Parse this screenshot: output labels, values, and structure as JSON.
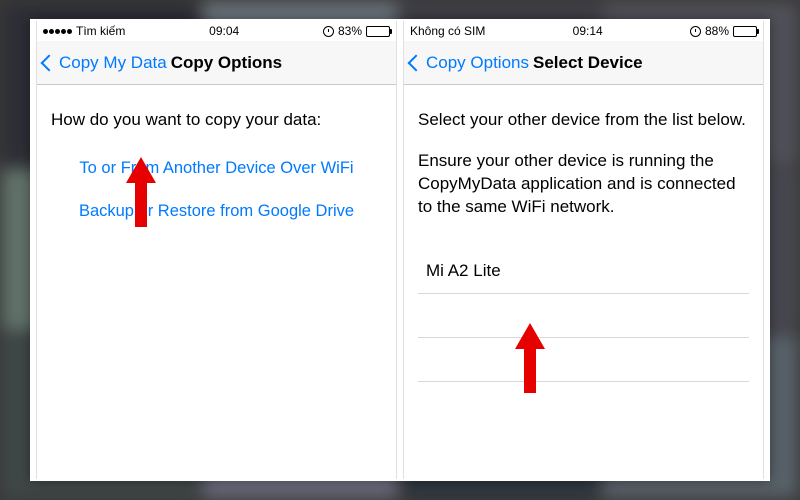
{
  "left": {
    "status": {
      "carrier": "Tìm kiếm",
      "time": "09:04",
      "battery_pct": "83%",
      "battery_fill": 83
    },
    "nav": {
      "back_label": "Copy My Data",
      "title": "Copy Options"
    },
    "prompt": "How do you want to copy your data:",
    "options": {
      "wifi": "To or From Another Device Over WiFi",
      "gdrive": "Backup or Restore from Google Drive"
    }
  },
  "right": {
    "status": {
      "carrier": "Không có SIM",
      "time": "09:14",
      "battery_pct": "88%",
      "battery_fill": 88
    },
    "nav": {
      "back_label": "Copy Options",
      "title": "Select Device"
    },
    "instr1": "Select your other device from the list below.",
    "instr2": "Ensure your other device is running the CopyMyData application and is connected to the same WiFi network.",
    "devices": {
      "0": "Mi A2 Lite"
    }
  }
}
